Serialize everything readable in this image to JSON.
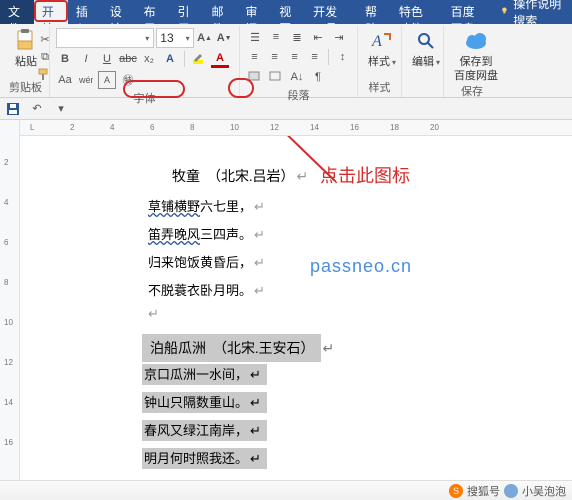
{
  "tabs": {
    "file": "文件",
    "home": "开始",
    "insert": "插入",
    "design": "设计",
    "layout": "布局",
    "references": "引用",
    "mailings": "邮件",
    "review": "审阅",
    "view": "视图",
    "devtools": "开发工具",
    "help": "帮助",
    "special": "特色功能",
    "netdisk": "百度网盘",
    "search": "操作说明搜索"
  },
  "ribbon": {
    "clipboard": {
      "paste": "粘贴",
      "label": "剪贴板"
    },
    "font": {
      "size": "13",
      "label": "字体"
    },
    "paragraph": {
      "label": "段落"
    },
    "styles": {
      "label": "样式"
    },
    "editing": {
      "label": "编辑"
    },
    "save": {
      "line1": "保存到",
      "line2": "百度网盘",
      "label": "保存"
    }
  },
  "annotation": {
    "text": "点击此图标"
  },
  "watermark": "passneo.cn",
  "doc": {
    "title": "牧童　（北宋.吕岩）",
    "l1a": "草铺横野",
    "l1b": "六七里，",
    "l2a": "笛弄晚风",
    "l2b": "三四声。",
    "l3": "归来饱饭黄昏后，",
    "l4": "不脱蓑衣卧月明。",
    "title2": "泊船瓜洲　（北宋.王安石）",
    "l5": "京口瓜洲一水间，",
    "l6": "钟山只隔数重山。",
    "l7": "春风又绿江南岸，",
    "l8": "明月何时照我还。"
  },
  "footer": {
    "brand": "搜狐号",
    "author": "小吴泡泡"
  }
}
